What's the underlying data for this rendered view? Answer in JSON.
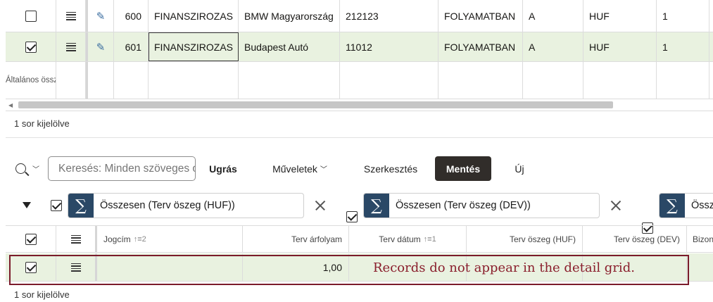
{
  "master_grid": {
    "rows": [
      {
        "id": "600",
        "type": "FINANSZIROZAS",
        "partner": "BMW Magyarország",
        "code": "212123",
        "status": "FOLYAMATBAN",
        "flag": "A",
        "currency": "HUF",
        "qty": "1",
        "selected": false
      },
      {
        "id": "601",
        "type": "FINANSZIROZAS",
        "partner": "Budapest Autó",
        "code": "11012",
        "status": "FOLYAMATBAN",
        "flag": "A",
        "currency": "HUF",
        "qty": "1",
        "selected": true
      }
    ],
    "aggregate_label": "Általános összesen",
    "status": "1 sor kijelölve"
  },
  "toolbar": {
    "search_placeholder": "Keresés: Minden szöveges oszlop",
    "goto_label": "Ugrás",
    "actions_label": "Műveletek",
    "edit_label": "Szerkesztés",
    "save_label": "Mentés",
    "new_label": "Új"
  },
  "filters": [
    {
      "label": "Összesen (Terv öszeg (HUF))"
    },
    {
      "label": "Összesen (Terv öszeg (DEV))"
    },
    {
      "label": "Össze"
    }
  ],
  "detail_grid": {
    "columns": {
      "jogcim": "Jogcím",
      "jogcim_sort": "↑≡2",
      "terv_arfolyam": "Terv árfolyam",
      "terv_datum": "Terv dátum",
      "terv_datum_sort": "↑≡1",
      "terv_oszeg_huf": "Terv öszeg (HUF)",
      "terv_oszeg_dev": "Terv öszeg (DEV)",
      "bizon": "Bizon"
    },
    "row": {
      "terv_arfolyam": "1,00"
    },
    "status": "1 sor kijelölve"
  },
  "annotation": "Records do not appear in the detail grid.",
  "colors": {
    "selected_row": "#e9f2e0",
    "sigma_bg": "#2a4866",
    "save_bg": "#312d2a",
    "annotation": "#7b1b2b"
  }
}
